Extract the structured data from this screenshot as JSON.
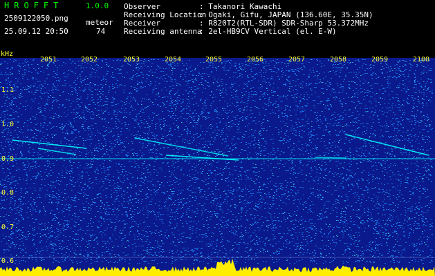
{
  "header": {
    "app_title": "HROFFT",
    "app_version": "1.0.0",
    "filename": "2509122050.png",
    "date_time": "25.09.12 20:50",
    "meteor_label": "meteor",
    "meteor_count": "74"
  },
  "info": [
    {
      "label": "Observer",
      "value": ": Takanori Kawachi"
    },
    {
      "label": "Receiving Location",
      "value": ": Ogaki, Gifu, JAPAN (136.60E, 35.35N)"
    },
    {
      "label": "Receiver",
      "value": ": R820T2(RTL-SDR) SDR-Sharp 53.372MHz"
    },
    {
      "label": "Receiving antenna",
      "value": ": 2el-HB9CV Vertical (el. E-W)"
    }
  ],
  "axis": {
    "unit_label": "kHz",
    "x_ticks": [
      "2051",
      "2052",
      "2053",
      "2054",
      "2055",
      "2056",
      "2057",
      "2058",
      "2059",
      "2100"
    ],
    "y_ticks": [
      "1.1",
      "1.0",
      "0.9",
      "0.8",
      "0.7",
      "0.6"
    ]
  },
  "colors": {
    "background": "#0a1a8c",
    "noise": "#1e8cff",
    "trace": "#00ffff",
    "level_bar": "#ffee00",
    "label_yellow": "#ffff33",
    "label_green": "#00ff00"
  }
}
